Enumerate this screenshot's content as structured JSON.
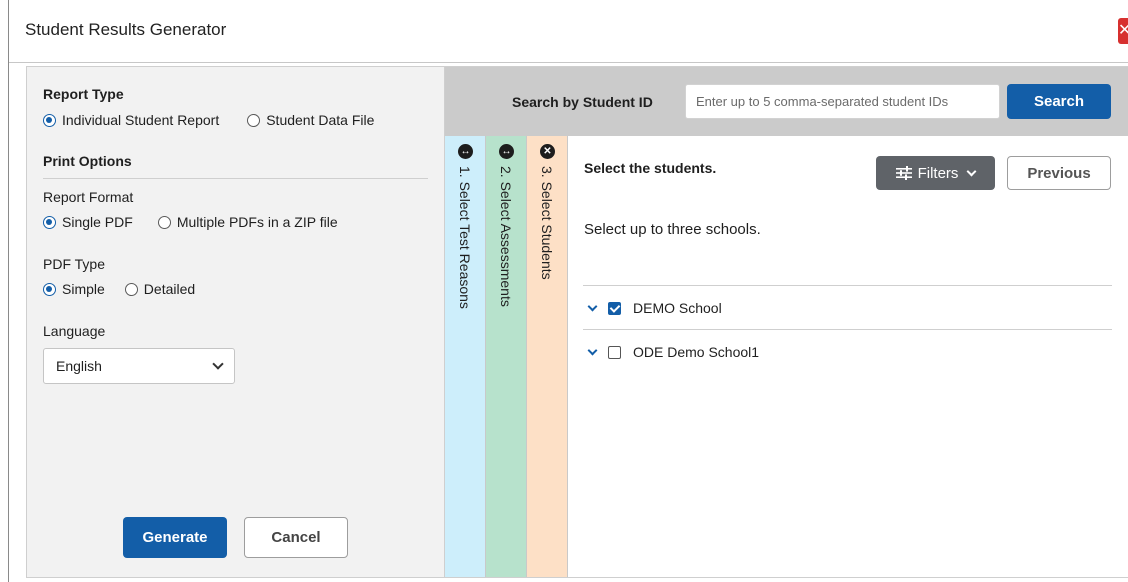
{
  "window": {
    "title": "Student Results Generator",
    "close_glyph": "✕"
  },
  "left_panel": {
    "report_type_title": "Report Type",
    "report_type_options": [
      {
        "label": "Individual Student Report",
        "selected": true
      },
      {
        "label": "Student Data File",
        "selected": false
      }
    ],
    "print_options_title": "Print Options",
    "report_format_label": "Report Format",
    "report_format_options": [
      {
        "label": "Single PDF",
        "selected": true
      },
      {
        "label": "Multiple PDFs in a ZIP file",
        "selected": false
      }
    ],
    "pdf_type_label": "PDF Type",
    "pdf_type_options": [
      {
        "label": "Simple",
        "selected": true
      },
      {
        "label": "Detailed",
        "selected": false
      }
    ],
    "language_label": "Language",
    "language_value": "English",
    "generate_label": "Generate",
    "cancel_label": "Cancel"
  },
  "search": {
    "label": "Search by Student ID",
    "placeholder": "Enter up to 5 comma-separated student IDs",
    "button_label": "Search"
  },
  "steps": [
    {
      "label": "1. Select Test Reasons",
      "icon": "expand-arrows-icon",
      "glyph": "↔",
      "color": "#cdeefb"
    },
    {
      "label": "2. Select Assessments",
      "icon": "expand-arrows-icon",
      "glyph": "↔",
      "color": "#b7e2cc"
    },
    {
      "label": "3. Select Students",
      "icon": "close-circle-icon",
      "glyph": "✕",
      "color": "#fde0c6"
    }
  ],
  "content": {
    "title": "Select the students.",
    "filters_label": "Filters",
    "filters_icon": "sliders-icon",
    "previous_label": "Previous",
    "instruction": "Select up to three schools.",
    "schools": [
      {
        "name": "DEMO School",
        "checked": true
      },
      {
        "name": "ODE Demo School1",
        "checked": false
      }
    ]
  },
  "colors": {
    "primary": "#135ea8",
    "close_red": "#d7302f",
    "filters_gray": "#5f6368"
  }
}
